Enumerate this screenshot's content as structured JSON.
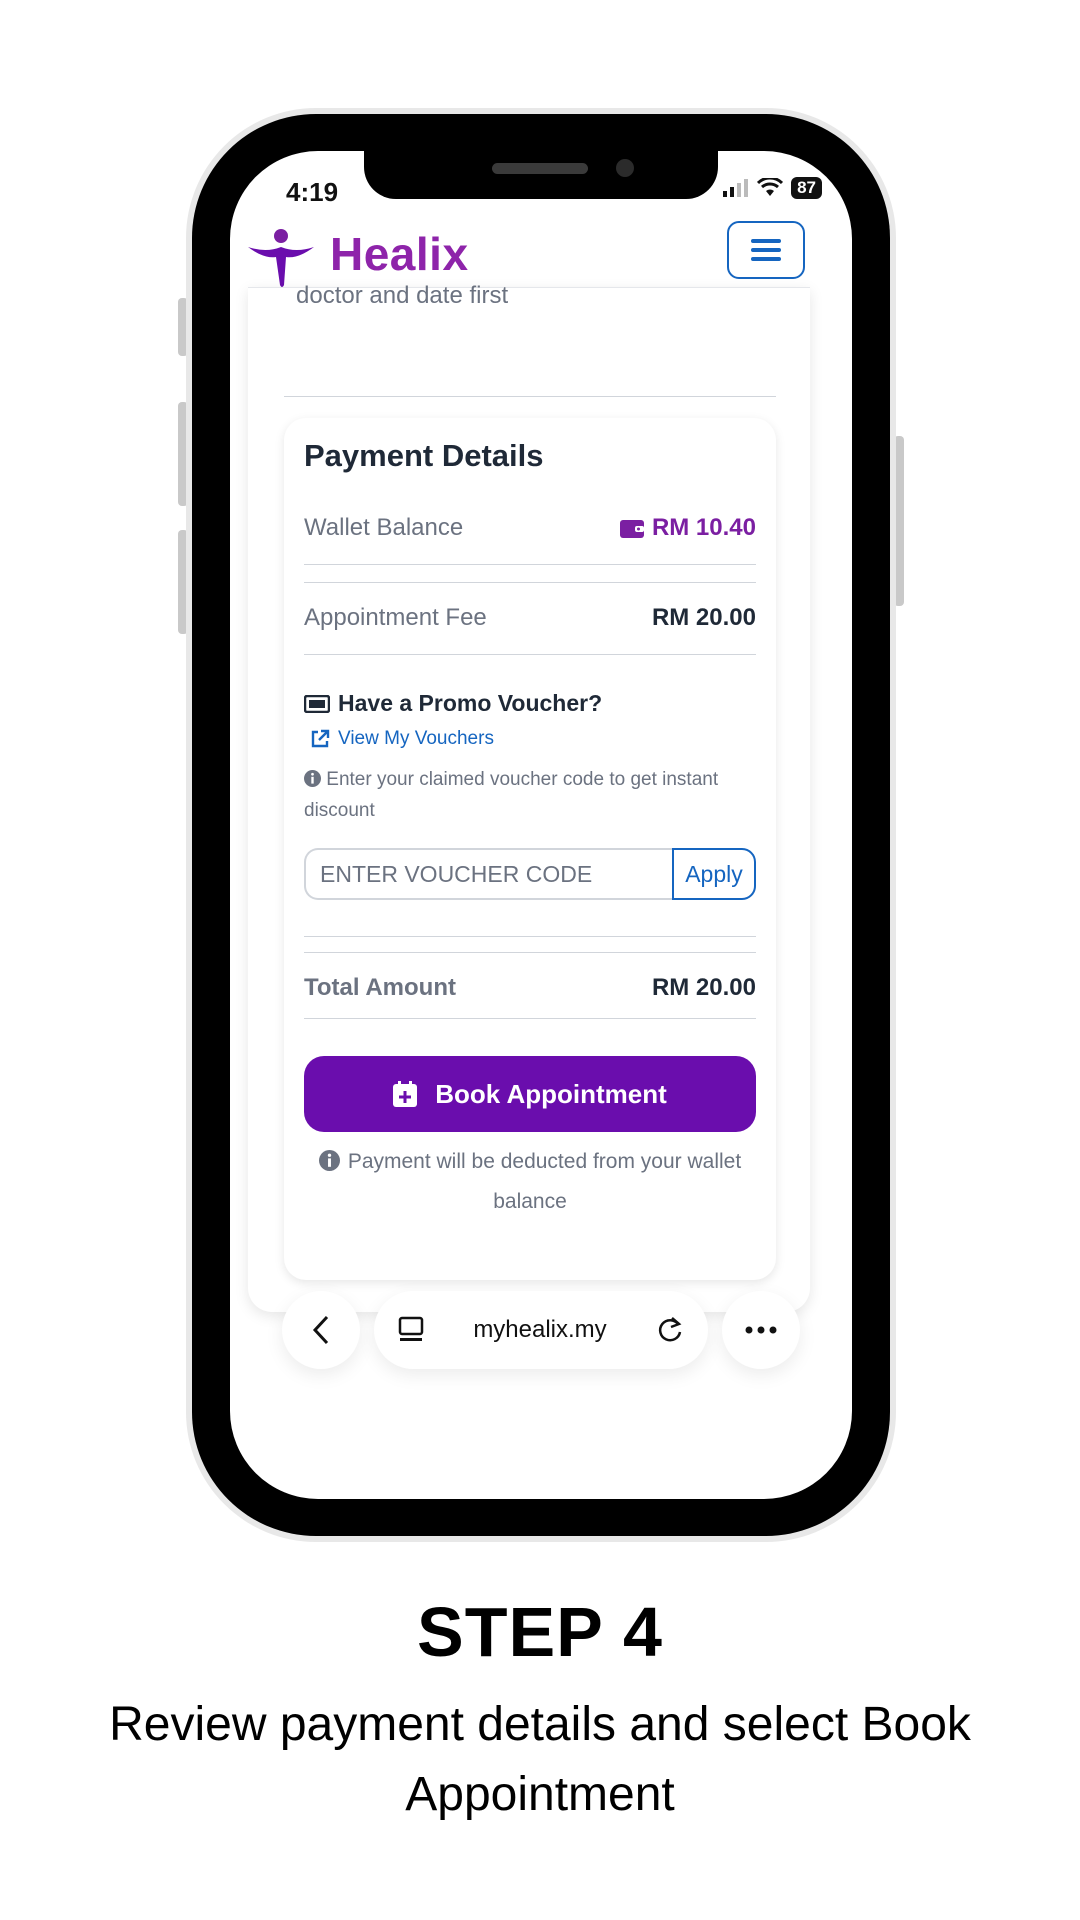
{
  "status_bar": {
    "time": "4:19",
    "battery": "87"
  },
  "app": {
    "brand": "Healix"
  },
  "page": {
    "clipped_text": "doctor and date first"
  },
  "payment": {
    "title": "Payment Details",
    "wallet_label": "Wallet Balance",
    "wallet_value": "RM 10.40",
    "fee_label": "Appointment Fee",
    "fee_value": "RM 20.00",
    "promo_title": "Have a Promo Voucher?",
    "vouchers_link": "View My Vouchers",
    "hint": "Enter your claimed voucher code to get instant discount",
    "voucher_placeholder": "ENTER VOUCHER CODE",
    "apply_label": "Apply",
    "total_label": "Total Amount",
    "total_value": "RM 20.00",
    "book_label": "Book Appointment",
    "note": "Payment will be deducted from your wallet balance"
  },
  "browser": {
    "url": "myhealix.my"
  },
  "caption": {
    "title": "STEP 4",
    "description": "Review payment details and select Book Appointment"
  },
  "colors": {
    "brand": "#8e24aa",
    "button": "#6a0dad",
    "link": "#1565c0"
  }
}
